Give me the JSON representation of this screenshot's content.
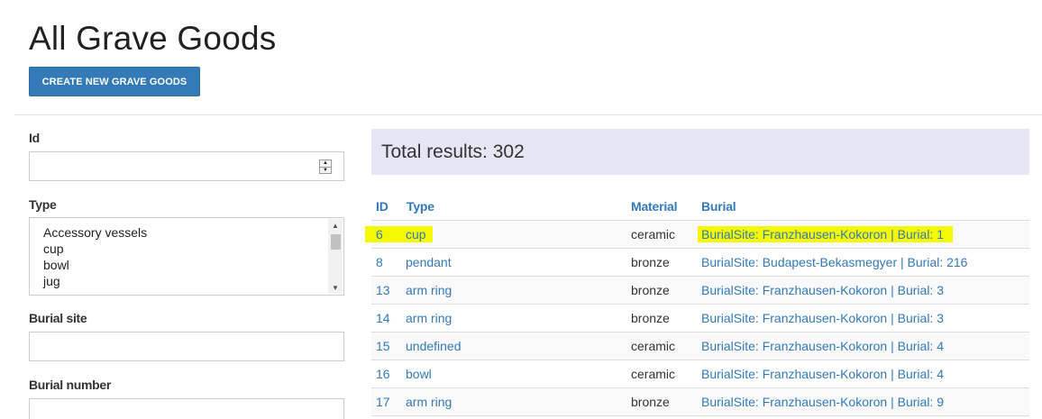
{
  "page": {
    "title": "All Grave Goods",
    "create_button": "CREATE NEW GRAVE GOODS"
  },
  "filters": {
    "id_label": "Id",
    "id_value": "",
    "type_label": "Type",
    "type_options": [
      "Accessory vessels",
      "cup",
      "bowl",
      "jug"
    ],
    "burial_site_label": "Burial site",
    "burial_site_value": "",
    "burial_number_label": "Burial number",
    "burial_number_value": ""
  },
  "results": {
    "total": "Total results: 302",
    "columns": {
      "id": "ID",
      "type": "Type",
      "material": "Material",
      "burial": "Burial"
    },
    "rows": [
      {
        "id": "6",
        "type": "cup",
        "material": "ceramic",
        "burial": "BurialSite: Franzhausen-Kokoron | Burial: 1",
        "highlighted": true
      },
      {
        "id": "8",
        "type": "pendant",
        "material": "bronze",
        "burial": "BurialSite: Budapest-Bekasmegyer | Burial: 216"
      },
      {
        "id": "13",
        "type": "arm ring",
        "material": "bronze",
        "burial": "BurialSite: Franzhausen-Kokoron | Burial: 3"
      },
      {
        "id": "14",
        "type": "arm ring",
        "material": "bronze",
        "burial": "BurialSite: Franzhausen-Kokoron | Burial: 3"
      },
      {
        "id": "15",
        "type": "undefined",
        "material": "ceramic",
        "burial": "BurialSite: Franzhausen-Kokoron | Burial: 4"
      },
      {
        "id": "16",
        "type": "bowl",
        "material": "ceramic",
        "burial": "BurialSite: Franzhausen-Kokoron | Burial: 4"
      },
      {
        "id": "17",
        "type": "arm ring",
        "material": "bronze",
        "burial": "BurialSite: Franzhausen-Kokoron | Burial: 9"
      }
    ]
  },
  "colors": {
    "link": "#337ab7",
    "button": "#337ab7",
    "highlight": "#f4f900",
    "total_box": "#e5e5f5"
  }
}
